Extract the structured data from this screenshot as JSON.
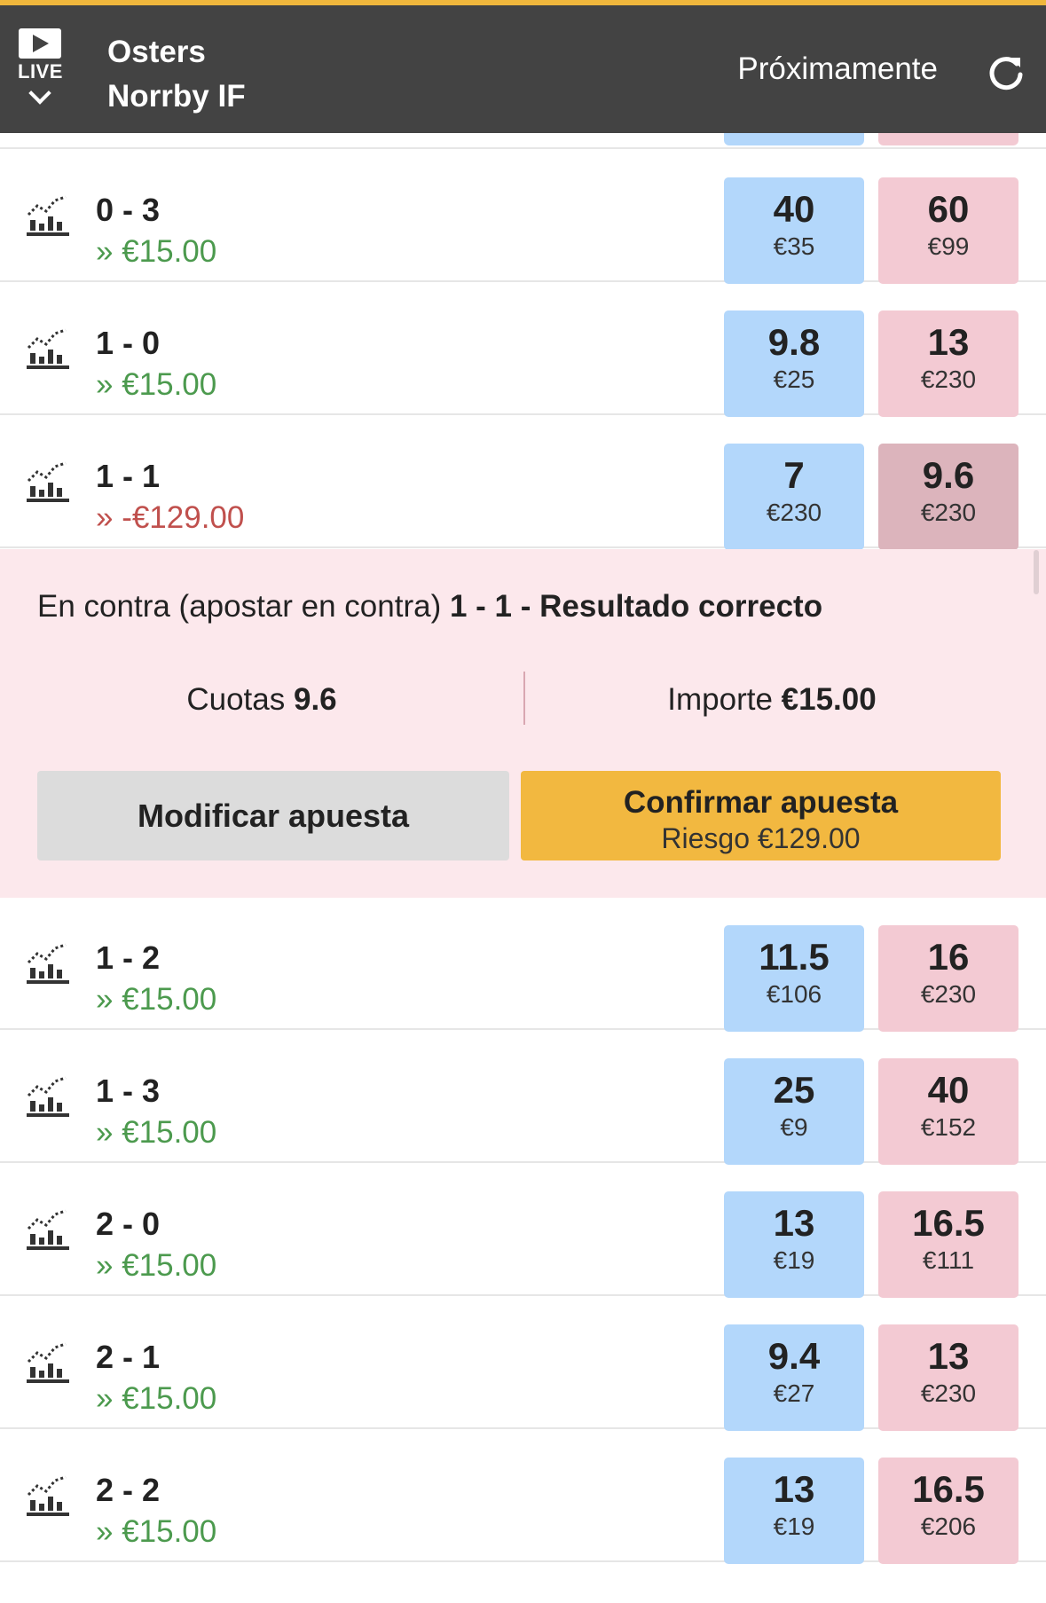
{
  "header": {
    "live_label": "LIVE",
    "team_home": "Osters",
    "team_away": "Norrby IF",
    "status": "Próximamente"
  },
  "rows_top": [
    {
      "score": "0 - 3",
      "pl": "» €15.00",
      "pl_type": "pos",
      "back_price": "40",
      "back_size": "€35",
      "lay_price": "60",
      "lay_size": "€99"
    },
    {
      "score": "1 - 0",
      "pl": "» €15.00",
      "pl_type": "pos",
      "back_price": "9.8",
      "back_size": "€25",
      "lay_price": "13",
      "lay_size": "€230"
    },
    {
      "score": "1 - 1",
      "pl": "» -€129.00",
      "pl_type": "neg",
      "back_price": "7",
      "back_size": "€230",
      "lay_price": "9.6",
      "lay_size": "€230"
    }
  ],
  "betslip": {
    "prefix": "En contra (apostar en contra)",
    "selection": "1 - 1 - Resultado correcto",
    "odds_label": "Cuotas",
    "odds_value": "9.6",
    "stake_label": "Importe",
    "stake_value": "€15.00",
    "modify_label": "Modificar apuesta",
    "confirm_label": "Confirmar apuesta",
    "risk_label": "Riesgo €129.00"
  },
  "rows_bottom": [
    {
      "score": "1 - 2",
      "pl": "» €15.00",
      "pl_type": "pos",
      "back_price": "11.5",
      "back_size": "€106",
      "lay_price": "16",
      "lay_size": "€230"
    },
    {
      "score": "1 - 3",
      "pl": "» €15.00",
      "pl_type": "pos",
      "back_price": "25",
      "back_size": "€9",
      "lay_price": "40",
      "lay_size": "€152"
    },
    {
      "score": "2 - 0",
      "pl": "» €15.00",
      "pl_type": "pos",
      "back_price": "13",
      "back_size": "€19",
      "lay_price": "16.5",
      "lay_size": "€111"
    },
    {
      "score": "2 - 1",
      "pl": "» €15.00",
      "pl_type": "pos",
      "back_price": "9.4",
      "back_size": "€27",
      "lay_price": "13",
      "lay_size": "€230"
    },
    {
      "score": "2 - 2",
      "pl": "» €15.00",
      "pl_type": "pos",
      "back_price": "13",
      "back_size": "€19",
      "lay_price": "16.5",
      "lay_size": "€206"
    }
  ],
  "icons": {
    "live": "play-icon",
    "chevron": "chevron-down-icon",
    "refresh": "refresh-icon",
    "row": "chart-icon"
  },
  "colors": {
    "header_bg": "#434343",
    "accent": "#f0b73c",
    "back": "#b3d7fb",
    "lay": "#f3cad3",
    "lay_active": "#dcb4bc",
    "profit": "#4c9a4e",
    "loss": "#c0504d",
    "slip_bg": "#fce8ec"
  }
}
